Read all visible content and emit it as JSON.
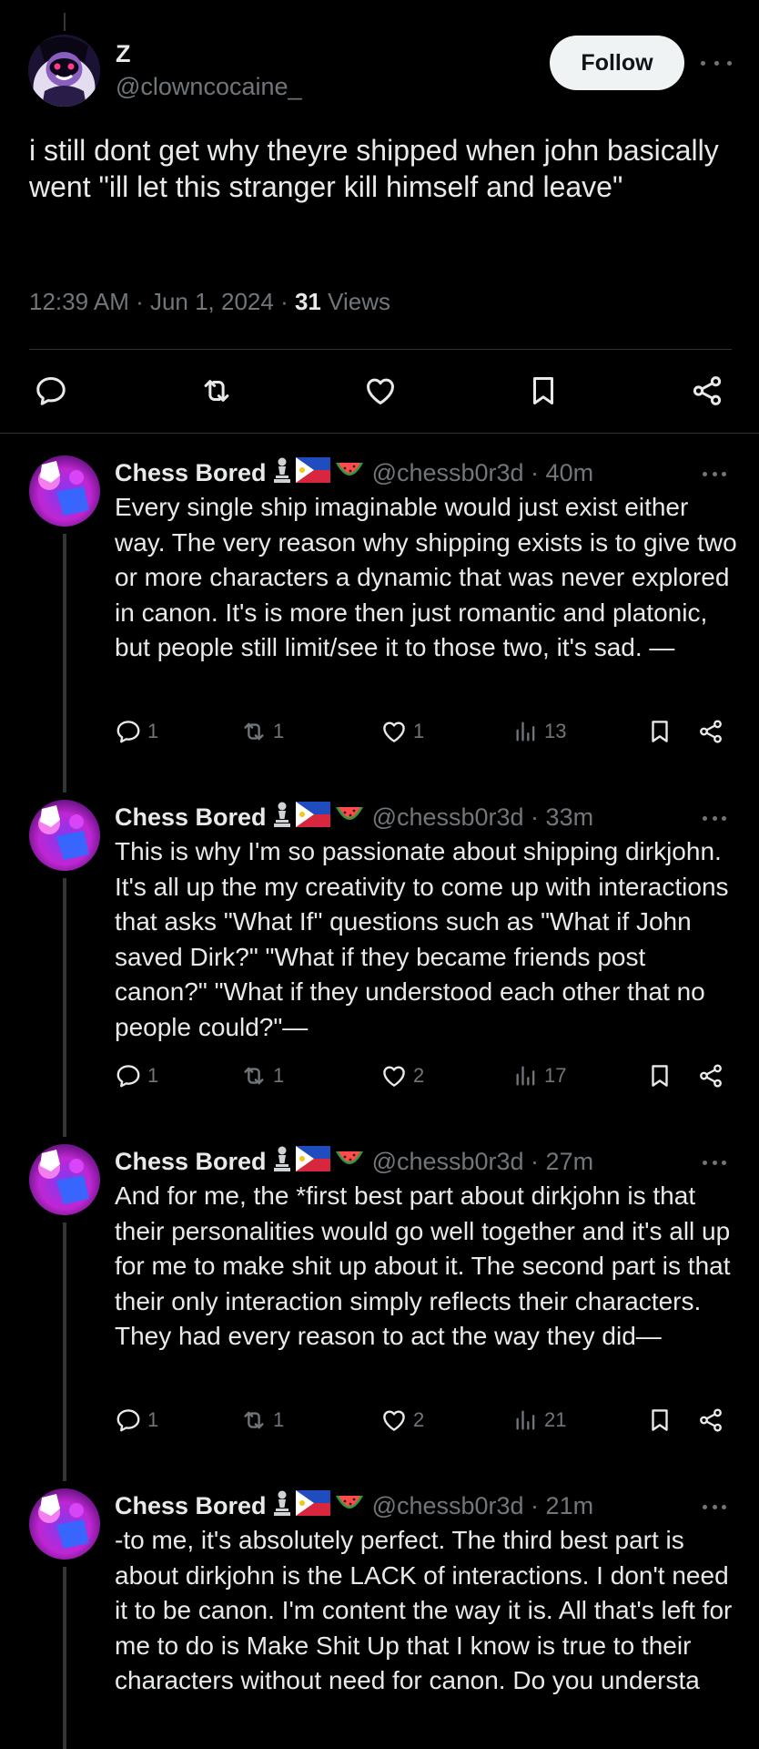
{
  "main": {
    "name": "Z",
    "handle": "@clowncocaine_",
    "follow_label": "Follow",
    "text": "i still dont get why theyre shipped when john basically went \"ill let this stranger kill himself and leave\"",
    "time": "12:39 AM · Jun 1, 2024 · ",
    "views_count": "31",
    "views_label": " Views",
    "actions": [
      "reply-icon",
      "retweet-icon",
      "like-icon",
      "bookmark-icon",
      "share-icon"
    ]
  },
  "replies": [
    {
      "name": "Chess Bored",
      "emoji": [
        "chess-pawn",
        "philippines-flag",
        "watermelon"
      ],
      "handle": "@chessb0r3d · 40m",
      "text": "Every single ship imaginable would just exist either way. The very reason why shipping exists is to give two or more characters a dynamic that was never explored in canon. It's is more then just romantic and platonic, but people still limit/see it to those two, it's sad. —",
      "replies": "1",
      "retweets": "1",
      "likes": "1",
      "views": "13"
    },
    {
      "name": "Chess Bored",
      "emoji": [
        "chess-pawn",
        "philippines-flag",
        "watermelon"
      ],
      "handle": "@chessb0r3d · 33m",
      "text": "This is why I'm so passionate about shipping dirkjohn. It's all up the my creativity to come up with interactions that asks \"What If\" questions such as \"What if John saved Dirk?\" \"What if they became friends post canon?\" \"What if they understood each other that no people could?\"—",
      "replies": "1",
      "retweets": "1",
      "likes": "2",
      "views": "17"
    },
    {
      "name": "Chess Bored",
      "emoji": [
        "chess-pawn",
        "philippines-flag",
        "watermelon"
      ],
      "handle": "@chessb0r3d · 27m",
      "text": "And for me, the *first best part about dirkjohn is that their personalities would go well together and it's all up for me to make shit up about it. The second part is that their only interaction simply reflects their characters. They had every reason to act the way they did—",
      "replies": "1",
      "retweets": "1",
      "likes": "2",
      "views": "21"
    },
    {
      "name": "Chess Bored",
      "emoji": [
        "chess-pawn",
        "philippines-flag",
        "watermelon"
      ],
      "handle": "@chessb0r3d · 21m",
      "text": "-to me, it's absolutely perfect. The third best part is about dirkjohn is the LACK of interactions. I don't need it to be canon. I'm content the way it is. All that's left for me to do is Make Shit Up that I know is true to their characters without need for canon. Do you understa"
    }
  ],
  "colors": {
    "background": "#000000",
    "text": "#e7e9ea",
    "muted": "#71767b",
    "divider": "#2f3336",
    "follow_bg": "#eff3f4"
  }
}
